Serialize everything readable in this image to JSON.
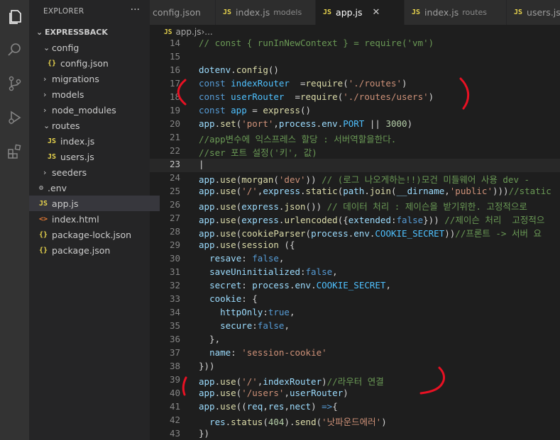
{
  "sidebar": {
    "title": "EXPLORER",
    "more": "···",
    "tree": [
      {
        "label": "EXPRESSBACK",
        "chevron": "⌄",
        "icon": "",
        "kind": "root"
      },
      {
        "label": "config",
        "chevron": "⌄",
        "icon": "",
        "kind": "folder"
      },
      {
        "label": "config.json",
        "chevron": "",
        "icon": "{}",
        "kind": "json"
      },
      {
        "label": "migrations",
        "chevron": "›",
        "icon": "",
        "kind": "folder"
      },
      {
        "label": "models",
        "chevron": "›",
        "icon": "",
        "kind": "folder"
      },
      {
        "label": "node_modules",
        "chevron": "›",
        "icon": "",
        "kind": "folder"
      },
      {
        "label": "routes",
        "chevron": "⌄",
        "icon": "",
        "kind": "folder"
      },
      {
        "label": "index.js",
        "chevron": "",
        "icon": "JS",
        "kind": "js"
      },
      {
        "label": "users.js",
        "chevron": "",
        "icon": "JS",
        "kind": "js"
      },
      {
        "label": "seeders",
        "chevron": "›",
        "icon": "",
        "kind": "folder"
      },
      {
        "label": ".env",
        "chevron": "",
        "icon": "⚙",
        "kind": "env"
      },
      {
        "label": "app.js",
        "chevron": "",
        "icon": "JS",
        "kind": "js"
      },
      {
        "label": "index.html",
        "chevron": "",
        "icon": "<>",
        "kind": "html"
      },
      {
        "label": "package-lock.json",
        "chevron": "",
        "icon": "{}",
        "kind": "json"
      },
      {
        "label": "package.json",
        "chevron": "",
        "icon": "{}",
        "kind": "json"
      }
    ]
  },
  "tabs": [
    {
      "icon": "",
      "label": "config.json",
      "desc": ""
    },
    {
      "icon": "JS",
      "label": "index.js",
      "desc": "models"
    },
    {
      "icon": "JS",
      "label": "app.js",
      "desc": "",
      "close": "✕"
    },
    {
      "icon": "JS",
      "label": "index.js",
      "desc": "routes"
    },
    {
      "icon": "JS",
      "label": "users.js",
      "desc": ""
    }
  ],
  "breadcrumb": {
    "icon": "JS",
    "file": "app.js",
    "sep": " › ",
    "rest": "..."
  },
  "editor": {
    "lines": [
      {
        "n": "14",
        "t": [
          [
            "cm",
            "// const { runInNewContext } = require('vm')"
          ]
        ]
      },
      {
        "n": "15",
        "t": []
      },
      {
        "n": "16",
        "t": [
          [
            "var",
            "dotenv"
          ],
          [
            "",
            "."
          ],
          [
            "fn",
            "config"
          ],
          [
            "",
            "()"
          ]
        ]
      },
      {
        "n": "17",
        "t": [
          [
            "kw",
            "const "
          ],
          [
            "cst",
            "indexRouter"
          ],
          [
            "",
            "  ="
          ],
          [
            "fn",
            "require"
          ],
          [
            "",
            "("
          ],
          [
            "str",
            "'./routes'"
          ],
          [
            "",
            ")"
          ]
        ]
      },
      {
        "n": "18",
        "t": [
          [
            "kw",
            "const "
          ],
          [
            "cst",
            "userRouter"
          ],
          [
            "",
            "  ="
          ],
          [
            "fn",
            "require"
          ],
          [
            "",
            "("
          ],
          [
            "str",
            "'./routes/users'"
          ],
          [
            "",
            ")"
          ]
        ]
      },
      {
        "n": "19",
        "t": [
          [
            "kw",
            "const "
          ],
          [
            "cst",
            "app"
          ],
          [
            "",
            " = "
          ],
          [
            "fn",
            "express"
          ],
          [
            "",
            "()"
          ]
        ]
      },
      {
        "n": "20",
        "t": [
          [
            "var",
            "app"
          ],
          [
            "",
            "."
          ],
          [
            "fn",
            "set"
          ],
          [
            "",
            "("
          ],
          [
            "str",
            "'port'"
          ],
          [
            "",
            ","
          ],
          [
            "var",
            "process"
          ],
          [
            "",
            "."
          ],
          [
            "var",
            "env"
          ],
          [
            "",
            "."
          ],
          [
            "cst",
            "PORT"
          ],
          [
            "",
            " || "
          ],
          [
            "num",
            "3000"
          ],
          [
            "",
            ")"
          ]
        ]
      },
      {
        "n": "21",
        "t": [
          [
            "cm",
            "//app변수에 익스프레스 할당 : 서버역할을한다."
          ]
        ]
      },
      {
        "n": "22",
        "t": [
          [
            "cm",
            "//ser 포트 설정('키', 값)"
          ]
        ]
      },
      {
        "n": "23",
        "t": [
          [
            "",
            "|"
          ]
        ],
        "current": true
      },
      {
        "n": "24",
        "t": [
          [
            "var",
            "app"
          ],
          [
            "",
            "."
          ],
          [
            "fn",
            "use"
          ],
          [
            "",
            "("
          ],
          [
            "fn",
            "morgan"
          ],
          [
            "",
            "("
          ],
          [
            "str",
            "'dev'"
          ],
          [
            "",
            ")) "
          ],
          [
            "cm",
            "// (로그 나오게하는!!)모건 미들웨어 사용 dev -"
          ]
        ]
      },
      {
        "n": "25",
        "t": [
          [
            "var",
            "app"
          ],
          [
            "",
            "."
          ],
          [
            "fn",
            "use"
          ],
          [
            "",
            "("
          ],
          [
            "str",
            "'/'"
          ],
          [
            "",
            ","
          ],
          [
            "var",
            "express"
          ],
          [
            "",
            "."
          ],
          [
            "fn",
            "static"
          ],
          [
            "",
            "("
          ],
          [
            "var",
            "path"
          ],
          [
            "",
            "."
          ],
          [
            "fn",
            "join"
          ],
          [
            "",
            "("
          ],
          [
            "var",
            "__dirname"
          ],
          [
            "",
            ","
          ],
          [
            "str",
            "'public'"
          ],
          [
            "",
            ")))"
          ],
          [
            "cm",
            "//static"
          ]
        ]
      },
      {
        "n": "26",
        "t": [
          [
            "var",
            "app"
          ],
          [
            "",
            "."
          ],
          [
            "fn",
            "use"
          ],
          [
            "",
            "("
          ],
          [
            "var",
            "express"
          ],
          [
            "",
            "."
          ],
          [
            "fn",
            "json"
          ],
          [
            "",
            "()) "
          ],
          [
            "cm",
            "// 데이터 처리 : 제이슨을 받기위한. 고정적으로"
          ]
        ]
      },
      {
        "n": "27",
        "t": [
          [
            "var",
            "app"
          ],
          [
            "",
            "."
          ],
          [
            "fn",
            "use"
          ],
          [
            "",
            "("
          ],
          [
            "var",
            "express"
          ],
          [
            "",
            "."
          ],
          [
            "fn",
            "urlencoded"
          ],
          [
            "",
            "({"
          ],
          [
            "var",
            "extended"
          ],
          [
            "",
            ":"
          ],
          [
            "kw",
            "false"
          ],
          [
            "",
            "})) "
          ],
          [
            "cm",
            "//제이슨 처리  고정적으"
          ]
        ]
      },
      {
        "n": "28",
        "t": [
          [
            "var",
            "app"
          ],
          [
            "",
            "."
          ],
          [
            "fn",
            "use"
          ],
          [
            "",
            "("
          ],
          [
            "fn",
            "cookieParser"
          ],
          [
            "",
            "("
          ],
          [
            "var",
            "process"
          ],
          [
            "",
            "."
          ],
          [
            "var",
            "env"
          ],
          [
            "",
            "."
          ],
          [
            "cst",
            "COOKIE_SECRET"
          ],
          [
            "",
            "))"
          ],
          [
            "cm",
            "//프론트 -> 서버 요"
          ]
        ]
      },
      {
        "n": "29",
        "t": [
          [
            "var",
            "app"
          ],
          [
            "",
            "."
          ],
          [
            "fn",
            "use"
          ],
          [
            "",
            "("
          ],
          [
            "fn",
            "session"
          ],
          [
            "",
            " ({"
          ]
        ]
      },
      {
        "n": "30",
        "t": [
          [
            "",
            "  "
          ],
          [
            "var",
            "resave"
          ],
          [
            "",
            ": "
          ],
          [
            "kw",
            "false"
          ],
          [
            "",
            ","
          ]
        ]
      },
      {
        "n": "31",
        "t": [
          [
            "",
            "  "
          ],
          [
            "var",
            "saveUninitialized"
          ],
          [
            "",
            ":"
          ],
          [
            "kw",
            "false"
          ],
          [
            "",
            ","
          ]
        ]
      },
      {
        "n": "32",
        "t": [
          [
            "",
            "  "
          ],
          [
            "var",
            "secret"
          ],
          [
            "",
            ": "
          ],
          [
            "var",
            "process"
          ],
          [
            "",
            "."
          ],
          [
            "var",
            "env"
          ],
          [
            "",
            "."
          ],
          [
            "cst",
            "COOKIE_SECRET"
          ],
          [
            "",
            ","
          ]
        ]
      },
      {
        "n": "33",
        "t": [
          [
            "",
            "  "
          ],
          [
            "var",
            "cookie"
          ],
          [
            "",
            ": {"
          ]
        ]
      },
      {
        "n": "34",
        "t": [
          [
            "",
            "    "
          ],
          [
            "var",
            "httpOnly"
          ],
          [
            "",
            ":"
          ],
          [
            "kw",
            "true"
          ],
          [
            "",
            ","
          ]
        ]
      },
      {
        "n": "35",
        "t": [
          [
            "",
            "    "
          ],
          [
            "var",
            "secure"
          ],
          [
            "",
            ":"
          ],
          [
            "kw",
            "false"
          ],
          [
            "",
            ","
          ]
        ]
      },
      {
        "n": "36",
        "t": [
          [
            "",
            "  },"
          ]
        ]
      },
      {
        "n": "37",
        "t": [
          [
            "",
            "  "
          ],
          [
            "var",
            "name"
          ],
          [
            "",
            ": "
          ],
          [
            "str",
            "'session-cookie'"
          ]
        ]
      },
      {
        "n": "38",
        "t": [
          [
            "",
            "}))"
          ]
        ]
      },
      {
        "n": "39",
        "t": [
          [
            "var",
            "app"
          ],
          [
            "",
            "."
          ],
          [
            "fn",
            "use"
          ],
          [
            "",
            "("
          ],
          [
            "str",
            "'/'"
          ],
          [
            "",
            ","
          ],
          [
            "var",
            "indexRouter"
          ],
          [
            "",
            ")"
          ],
          [
            "cm",
            "//라우터 연결"
          ]
        ]
      },
      {
        "n": "40",
        "t": [
          [
            "var",
            "app"
          ],
          [
            "",
            "."
          ],
          [
            "fn",
            "use"
          ],
          [
            "",
            "("
          ],
          [
            "str",
            "'/users'"
          ],
          [
            "",
            ","
          ],
          [
            "var",
            "userRouter"
          ],
          [
            "",
            ")"
          ]
        ]
      },
      {
        "n": "41",
        "t": [
          [
            "var",
            "app"
          ],
          [
            "",
            "."
          ],
          [
            "fn",
            "use"
          ],
          [
            "",
            "(("
          ],
          [
            "var",
            "req"
          ],
          [
            "",
            ","
          ],
          [
            "var",
            "res"
          ],
          [
            "",
            ","
          ],
          [
            "var",
            "nect"
          ],
          [
            "",
            ") "
          ],
          [
            "kw",
            "=>"
          ],
          [
            "",
            "{"
          ]
        ]
      },
      {
        "n": "42",
        "t": [
          [
            "",
            "  "
          ],
          [
            "var",
            "res"
          ],
          [
            "",
            "."
          ],
          [
            "fn",
            "status"
          ],
          [
            "",
            "("
          ],
          [
            "num",
            "404"
          ],
          [
            "",
            ")."
          ],
          [
            "fn",
            "send"
          ],
          [
            "",
            "("
          ],
          [
            "str",
            "'낫파운드에러'"
          ],
          [
            "",
            ")"
          ]
        ]
      },
      {
        "n": "43",
        "t": [
          [
            "",
            "})"
          ]
        ]
      }
    ]
  },
  "annotation_color": "#e81123"
}
